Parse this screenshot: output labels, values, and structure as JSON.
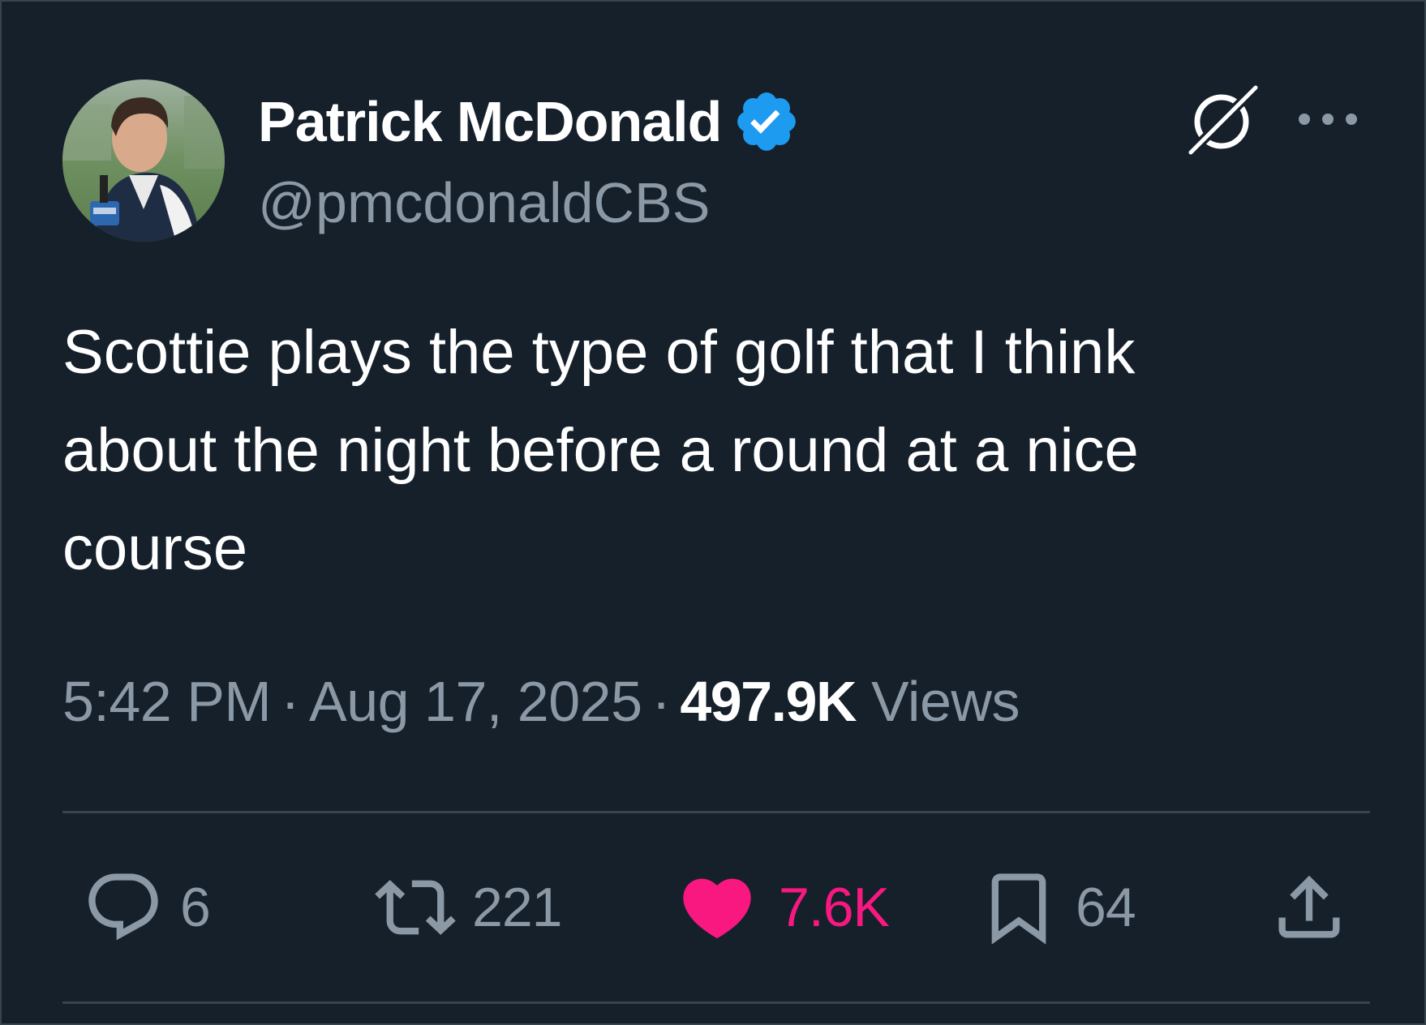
{
  "author": {
    "display_name": "Patrick McDonald",
    "handle": "@pmcdonaldCBS",
    "verified": true,
    "verified_color": "#1d9bf0",
    "avatar_icon": "profile-photo"
  },
  "header_icons": [
    "grok-icon",
    "more-icon"
  ],
  "tweet": {
    "text": "Scottie plays the type of golf that I think\nabout the night before a round at a nice\ncourse"
  },
  "meta": {
    "time": "5:42 PM",
    "separator": "·",
    "date": "Aug 17, 2025",
    "views_count": "497.9K",
    "views_label": "Views"
  },
  "actions": {
    "replies": "6",
    "retweets": "221",
    "likes": "7.6K",
    "bookmarks": "64"
  },
  "colors": {
    "background": "#15202b",
    "text_primary": "#ffffff",
    "text_secondary": "#8b98a5",
    "divider": "#38444d",
    "like_active": "#f91880"
  }
}
